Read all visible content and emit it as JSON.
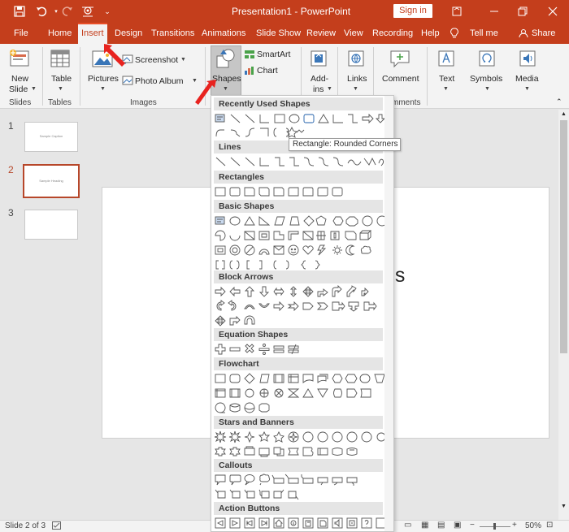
{
  "title_bar": {
    "title": "Presentation1 - PowerPoint",
    "signin_label": "Sign in",
    "qat_icons": [
      "save-icon",
      "undo-icon",
      "redo-icon",
      "presenter-icon",
      "customize-icon"
    ]
  },
  "tabs": {
    "file": "File",
    "home": "Home",
    "insert": "Insert",
    "design": "Design",
    "transitions": "Transitions",
    "animations": "Animations",
    "slideshow": "Slide Show",
    "review": "Review",
    "view": "View",
    "recording": "Recording",
    "help": "Help",
    "tellme": "Tell me",
    "share": "Share"
  },
  "ribbon": {
    "new_slide_line1": "New",
    "new_slide_line2": "Slide",
    "table": "Table",
    "pictures": "Pictures",
    "screenshot": "Screenshot",
    "photo_album": "Photo Album",
    "shapes": "Shapes",
    "smartart": "SmartArt",
    "chart": "Chart",
    "addins_line1": "Add-",
    "addins_line2": "ins",
    "links": "Links",
    "comment": "Comment",
    "text": "Text",
    "symbols": "Symbols",
    "media": "Media",
    "groups": {
      "slides": "Slides",
      "tables": "Tables",
      "images": "Images",
      "comments": "mments"
    }
  },
  "slide_pane": {
    "slides": [
      {
        "number": "1",
        "thumb_text": "Sample Caption"
      },
      {
        "number": "2",
        "thumb_text": "Sample Heading"
      },
      {
        "number": "3",
        "thumb_text": ""
      }
    ]
  },
  "canvas": {
    "visible_text_fragment": "es"
  },
  "shapes_menu": {
    "categories": [
      "Recently Used Shapes",
      "Lines",
      "Rectangles",
      "Basic Shapes",
      "Block Arrows",
      "Equation Shapes",
      "Flowchart",
      "Stars and Banners",
      "Callouts",
      "Action Buttons"
    ],
    "tooltip": "Rectangle: Rounded Corners"
  },
  "status_bar": {
    "slide_info": "Slide 2 of 3",
    "zoom": "50%"
  },
  "colors": {
    "accent": "#c43e1c",
    "annotation_arrow": "#e8231f"
  }
}
